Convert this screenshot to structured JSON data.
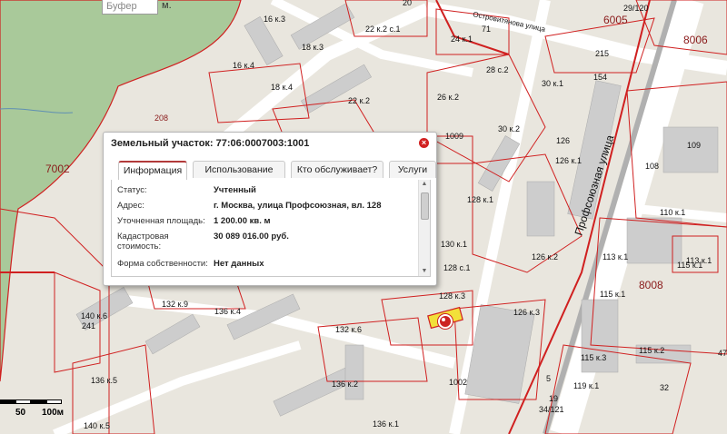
{
  "map": {
    "buffer_placeholder": "Буфер",
    "buffer_unit": "м.",
    "scale_labels": [
      "50",
      "100м"
    ],
    "street_labels": [
      "Профсоюзная улица",
      "Островитянова улица"
    ],
    "block_labels": [
      "7002",
      "8006",
      "8008",
      "6005",
      "208"
    ],
    "parcel_labels": [
      "16 к.3",
      "18 к.3",
      "16 к.4",
      "18 к.4",
      "22 к.2",
      "22 к.2 с.1",
      "20",
      "24 к.1",
      "28 с.2",
      "26 к.2",
      "30 к.1",
      "30 к.2",
      "1009",
      "126",
      "126 к.1",
      "128 к.1",
      "130 к.1",
      "128 с.1",
      "128 к.3",
      "126 к.2",
      "126 к.3",
      "132 к.9",
      "136 к.4",
      "140 к.6",
      "136 к.5",
      "140 к.5",
      "132 к.6",
      "136 к.2",
      "136 к.1",
      "115 к.1",
      "115 к.2",
      "115 к.3",
      "113 к.1",
      "115 к.1",
      "109",
      "119 к.1",
      "34/121",
      "32",
      "29/120",
      "113 к.1",
      "110 к.1",
      "108",
      "47",
      "154",
      "241",
      "1002",
      "5",
      "19",
      "215",
      "71"
    ]
  },
  "popup": {
    "title": "Земельный участок: 77:06:0007003:1001",
    "close_symbol": "×",
    "tabs": [
      "Информация",
      "Использование",
      "Кто обслуживает?",
      "Услуги"
    ],
    "active_tab": "Информация",
    "rows": [
      {
        "label": "Статус:",
        "value": "Учтенный"
      },
      {
        "label": "Адрес:",
        "value": "г. Москва, улица Профсоюзная, вл. 128"
      },
      {
        "label": "Уточненная площадь:",
        "value": "1 200.00 кв. м"
      },
      {
        "label": "Кадастровая стоимость:",
        "value": "30 089 016.00 руб."
      },
      {
        "label": "Форма собственности:",
        "value": "Нет данных"
      }
    ]
  },
  "colors": {
    "background": "#e9e6de",
    "forest": "#a9c99a",
    "road": "#ffffff",
    "parcel_border": "#d02020",
    "building": "#cdcdcd",
    "railway": "#b0b0b0",
    "highlight": "#f2e03a"
  }
}
